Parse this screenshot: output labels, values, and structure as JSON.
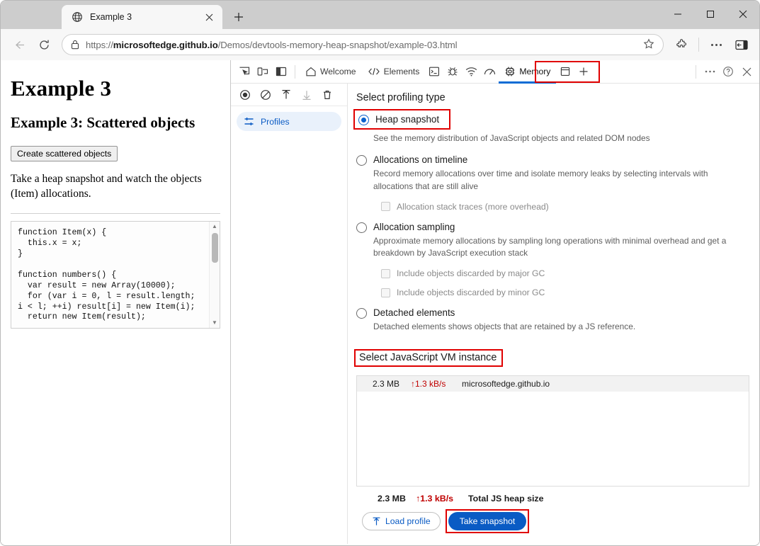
{
  "browser": {
    "tab": {
      "title": "Example 3",
      "favicon_icon": "globe-icon",
      "close_icon": "close-icon"
    },
    "new_tab_icon": "plus-icon",
    "window_controls": {
      "minimize": "minimize-icon",
      "maximize": "maximize-icon",
      "close": "close-icon"
    },
    "nav": {
      "back_icon": "arrow-left-icon",
      "refresh_icon": "refresh-icon",
      "lock_icon": "lock-icon",
      "url_prefix": "https://",
      "url_domain": "microsoftedge.github.io",
      "url_path": "/Demos/devtools-memory-heap-snapshot/example-03.html",
      "favorite_icon": "star-icon",
      "extensions_icon": "puzzle-icon",
      "settings_icon": "ellipsis-icon",
      "sidebar_icon": "sidebar-toggle-icon"
    }
  },
  "page": {
    "h1": "Example 3",
    "h2": "Example 3: Scattered objects",
    "button": "Create scattered objects",
    "paragraph": "Take a heap snapshot and watch the objects (Item) allocations.",
    "code": "function Item(x) {\n  this.x = x;\n}\n\nfunction numbers() {\n  var result = new Array(10000);\n  for (var i = 0, l = result.length;\ni < l; ++i) result[i] = new Item(i);\n  return new Item(result);"
  },
  "devtools": {
    "toolbar": {
      "inspect_icon": "inspect-element-icon",
      "device_icon": "device-emulation-icon",
      "dock_icon": "dock-side-icon",
      "tabs": [
        {
          "label": "Welcome",
          "icon": "home-icon",
          "active": false
        },
        {
          "label": "Elements",
          "icon": "code-brackets-icon",
          "active": false
        },
        {
          "label": "",
          "icon": "console-icon",
          "active": false
        },
        {
          "label": "",
          "icon": "debugger-bug-icon",
          "active": false
        },
        {
          "label": "",
          "icon": "network-wifi-icon",
          "active": false
        },
        {
          "label": "",
          "icon": "performance-gauge-icon",
          "active": false
        },
        {
          "label": "Memory",
          "icon": "memory-chip-icon",
          "active": true
        },
        {
          "label": "",
          "icon": "application-window-icon",
          "active": false
        }
      ],
      "more_tabs_icon": "plus-icon",
      "more_options_icon": "ellipsis-icon",
      "help_icon": "help-question-icon",
      "close_icon": "close-icon"
    },
    "sidebar": {
      "tools": [
        {
          "name": "record-icon"
        },
        {
          "name": "clear-icon"
        },
        {
          "name": "load-profile-icon"
        },
        {
          "name": "save-profile-icon"
        },
        {
          "name": "delete-icon"
        }
      ],
      "items": [
        {
          "label": "Profiles",
          "icon": "filter-sliders-icon",
          "selected": true
        }
      ]
    },
    "main": {
      "profiling_title": "Select profiling type",
      "options": [
        {
          "label": "Heap snapshot",
          "checked": true,
          "highlighted": true,
          "description": "See the memory distribution of JavaScript objects and related DOM nodes",
          "sub_options": []
        },
        {
          "label": "Allocations on timeline",
          "checked": false,
          "highlighted": false,
          "description": "Record memory allocations over time and isolate memory leaks by selecting intervals with allocations that are still alive",
          "sub_options": [
            {
              "label": "Allocation stack traces (more overhead)",
              "checked": false
            }
          ]
        },
        {
          "label": "Allocation sampling",
          "checked": false,
          "highlighted": false,
          "description": "Approximate memory allocations by sampling long operations with minimal overhead and get a breakdown by JavaScript execution stack",
          "sub_options": [
            {
              "label": "Include objects discarded by major GC",
              "checked": false
            },
            {
              "label": "Include objects discarded by minor GC",
              "checked": false
            }
          ]
        },
        {
          "label": "Detached elements",
          "checked": false,
          "highlighted": false,
          "description": "Detached elements shows objects that are retained by a JS reference.",
          "sub_options": []
        }
      ],
      "vm_title": "Select JavaScript VM instance",
      "vm_rows": [
        {
          "size": "2.3 MB",
          "rate": "↑1.3 kB/s",
          "name": "microsoftedge.github.io"
        }
      ],
      "heap_total": {
        "size": "2.3 MB",
        "rate": "↑1.3 kB/s",
        "label": "Total JS heap size"
      },
      "load_profile_label": "Load profile",
      "load_profile_icon": "upload-arrow-icon",
      "take_snapshot_label": "Take snapshot"
    }
  },
  "colors": {
    "accent": "#0a5bc4",
    "highlight": "#e00000",
    "rate": "#c00000",
    "tab_underline": "#0a6cd4"
  }
}
